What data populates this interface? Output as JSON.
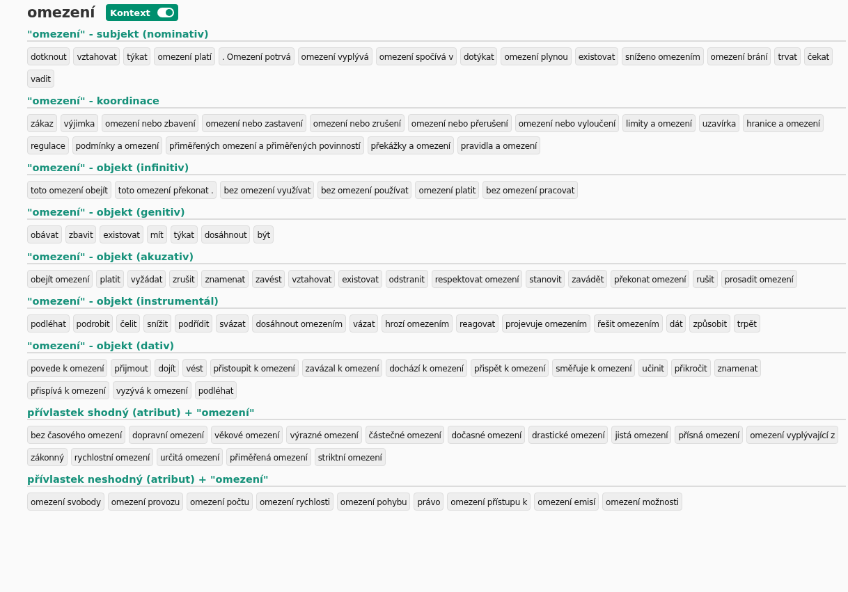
{
  "title": "omezení",
  "context_toggle": {
    "label": "Kontext",
    "on": true
  },
  "sections": [
    {
      "heading": "\"omezení\" - subjekt (nominativ)",
      "items": [
        "dotknout",
        "vztahovat",
        "týkat",
        "omezení platí",
        ". Omezení potrvá",
        "omezení vyplývá",
        "omezení spočívá v",
        "dotýkat",
        "omezení plynou",
        "existovat",
        "sníženo omezením",
        "omezení brání",
        "trvat",
        "čekat",
        "vadit"
      ]
    },
    {
      "heading": "\"omezení\" - koordinace",
      "items": [
        "zákaz",
        "výjimka",
        "omezení nebo zbavení",
        "omezení nebo zastavení",
        "omezení nebo zrušení",
        "omezení nebo přerušení",
        "omezení nebo vyloučení",
        "limity a omezení",
        "uzavírka",
        "hranice a omezení",
        "regulace",
        "podmínky a omezení",
        "přiměřených omezení a přiměřených povinností",
        "překážky a omezení",
        "pravidla a omezení"
      ]
    },
    {
      "heading": "\"omezení\" - objekt (infinitiv)",
      "items": [
        "toto omezení obejít",
        "toto omezení překonat .",
        "bez omezení využívat",
        "bez omezení používat",
        "omezení platit",
        "bez omezení pracovat"
      ]
    },
    {
      "heading": "\"omezení\" - objekt (genitiv)",
      "items": [
        "obávat",
        "zbavit",
        "existovat",
        "mít",
        "týkat",
        "dosáhnout",
        "být"
      ]
    },
    {
      "heading": "\"omezení\" - objekt (akuzativ)",
      "items": [
        "obejít omezení",
        "platit",
        "vyžádat",
        "zrušit",
        "znamenat",
        "zavést",
        "vztahovat",
        "existovat",
        "odstranit",
        "respektovat omezení",
        "stanovit",
        "zavádět",
        "překonat omezení",
        "rušit",
        "prosadit omezení"
      ]
    },
    {
      "heading": "\"omezení\" - objekt (instrumentál)",
      "items": [
        "podléhat",
        "podrobit",
        "čelit",
        "snížit",
        "podřídit",
        "svázat",
        "dosáhnout omezením",
        "vázat",
        "hrozí omezením",
        "reagovat",
        "projevuje omezením",
        "řešit omezením",
        "dát",
        "způsobit",
        "trpět"
      ]
    },
    {
      "heading": "\"omezení\" - objekt (dativ)",
      "items": [
        "povede k omezení",
        "přijmout",
        "dojít",
        "vést",
        "přistoupit k omezení",
        "zavázal k omezení",
        "dochází k omezení",
        "přispět k omezení",
        "směřuje k omezení",
        "učinit",
        "přikročit",
        "znamenat",
        "přispívá k omezení",
        "vyzývá k omezení",
        "podléhat"
      ]
    },
    {
      "heading": "přívlastek shodný (atribut) + \"omezení\"",
      "items": [
        "bez časového omezení",
        "dopravní omezení",
        "věkové omezení",
        "výrazné omezení",
        "částečné omezení",
        "dočasné omezení",
        "drastické omezení",
        "jistá omezení",
        "přísná omezení",
        "omezení vyplývající z",
        "zákonný",
        "rychlostní omezení",
        "určitá omezení",
        "přiměřená omezení",
        "striktní omezení"
      ]
    },
    {
      "heading": "přívlastek neshodný (atribut) + \"omezení\"",
      "items": [
        "omezení svobody",
        "omezení provozu",
        "omezení počtu",
        "omezení rychlosti",
        "omezení pohybu",
        "právo",
        "omezení přístupu k",
        "omezení emisí",
        "omezení možnosti"
      ]
    }
  ]
}
